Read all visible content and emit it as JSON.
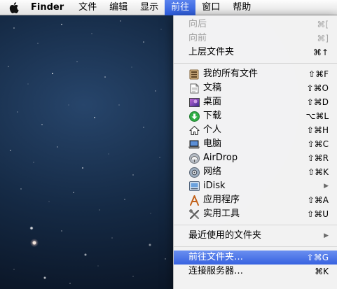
{
  "menubar": {
    "app_name": "Finder",
    "items": [
      "文件",
      "编辑",
      "显示",
      "前往",
      "窗口",
      "帮助"
    ]
  },
  "menu": {
    "group1": [
      {
        "label": "向后",
        "shortcut": "⌘[",
        "enabled": false
      },
      {
        "label": "向前",
        "shortcut": "⌘]",
        "enabled": false
      },
      {
        "label": "上层文件夹",
        "shortcut": "⌘↑",
        "enabled": true
      }
    ],
    "group2": [
      {
        "label": "我的所有文件",
        "shortcut": "⇧⌘F",
        "icon": "all-files-icon"
      },
      {
        "label": "文稿",
        "shortcut": "⇧⌘O",
        "icon": "documents-icon"
      },
      {
        "label": "桌面",
        "shortcut": "⇧⌘D",
        "icon": "desktop-icon"
      },
      {
        "label": "下载",
        "shortcut": "⌥⌘L",
        "icon": "downloads-icon"
      },
      {
        "label": "个人",
        "shortcut": "⇧⌘H",
        "icon": "home-icon"
      },
      {
        "label": "电脑",
        "shortcut": "⇧⌘C",
        "icon": "computer-icon"
      },
      {
        "label": "AirDrop",
        "shortcut": "⇧⌘R",
        "icon": "airdrop-icon"
      },
      {
        "label": "网络",
        "shortcut": "⇧⌘K",
        "icon": "network-icon"
      },
      {
        "label": "iDisk",
        "submenu": true,
        "icon": "idisk-icon"
      },
      {
        "label": "应用程序",
        "shortcut": "⇧⌘A",
        "icon": "applications-icon"
      },
      {
        "label": "实用工具",
        "shortcut": "⇧⌘U",
        "icon": "utilities-icon"
      }
    ],
    "recent": {
      "label": "最近使用的文件夹",
      "submenu": true
    },
    "goto_folder": {
      "label": "前往文件夹…",
      "shortcut": "⇧⌘G"
    },
    "connect_server": {
      "label": "连接服务器…",
      "shortcut": "⌘K"
    }
  }
}
